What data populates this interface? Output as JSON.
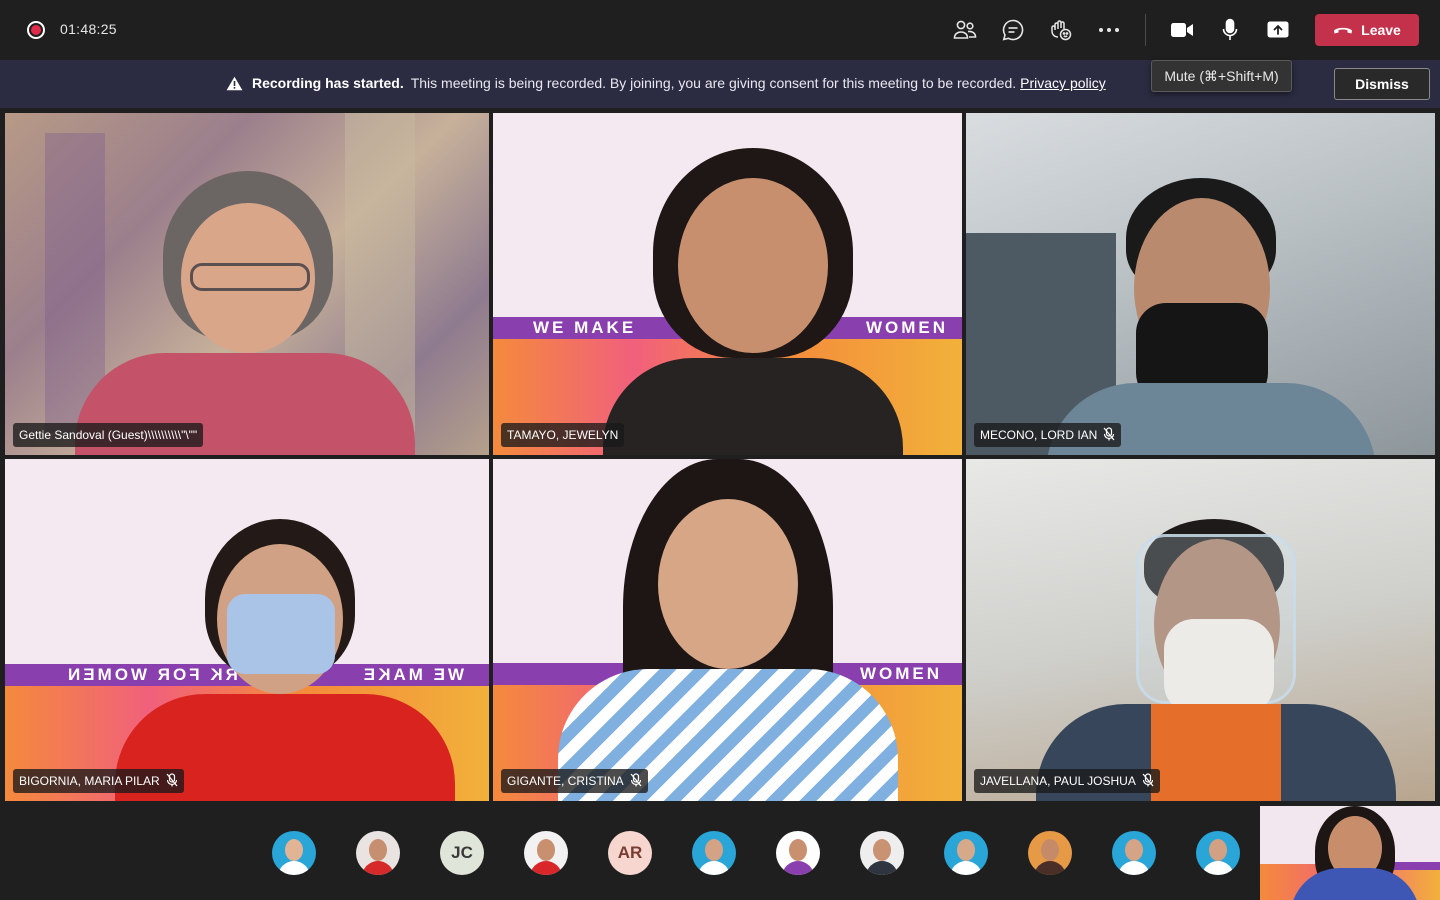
{
  "topbar": {
    "recording_time": "01:48:25",
    "leave_label": "Leave"
  },
  "icons": {
    "people": "people-icon",
    "chat": "chat-icon",
    "raise_hand": "raise-hand-icon",
    "more": "more-options-icon",
    "camera": "camera-icon",
    "mic": "microphone-icon",
    "share": "share-screen-icon",
    "hangup": "hang-up-phone-icon"
  },
  "tooltip": {
    "text": "Mute (⌘+Shift+M)"
  },
  "banner": {
    "title": "Recording has started.",
    "message": "This meeting is being recorded. By joining, you are giving consent for this meeting to be recorded.",
    "link": "Privacy policy",
    "dismiss_label": "Dismiss"
  },
  "participants": [
    {
      "name": "Gettie Sandoval (Guest)\\\\\\\\\\\\\\\\\\\\\"\\\"\"",
      "muted": false
    },
    {
      "name": "TAMAYO, JEWELYN",
      "muted": false
    },
    {
      "name": "MECONO, LORD IAN",
      "muted": true
    },
    {
      "name": "BIGORNIA, MARIA PILAR",
      "muted": true
    },
    {
      "name": "GIGANTE, CRISTINA",
      "muted": true
    },
    {
      "name": "JAVELLANA, PAUL JOSHUA",
      "muted": true
    }
  ],
  "backdrop": {
    "we_make": "WE MAKE",
    "women": "WOMEN",
    "we_make_mirrored": "WE MAKE",
    "work_for_women_mirrored": "WORK FOR WOMEN"
  },
  "roster": [
    {
      "type": "photo"
    },
    {
      "type": "photo"
    },
    {
      "type": "initials",
      "initials": "JC"
    },
    {
      "type": "photo"
    },
    {
      "type": "initials",
      "initials": "AR"
    },
    {
      "type": "photo"
    },
    {
      "type": "photo"
    },
    {
      "type": "photo"
    },
    {
      "type": "photo"
    },
    {
      "type": "photo"
    },
    {
      "type": "photo"
    },
    {
      "type": "photo"
    }
  ],
  "colors": {
    "leave_red": "#c4314b",
    "recording_red": "#e02b4b",
    "banner_bg": "#2b2c42",
    "backdrop_purple": "#8a3fae"
  }
}
